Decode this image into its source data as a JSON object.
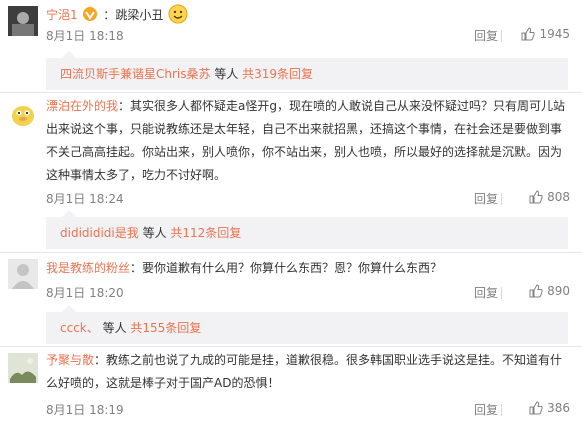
{
  "comments": [
    {
      "user": "宁浥1",
      "text_before": "：",
      "text": "跳梁小丑",
      "time": "8月1日 18:18",
      "reply": "回复",
      "likes": "1945",
      "sub": {
        "users": "四流贝斯手兼谐星Chris桑苏",
        "middle": " 等人 ",
        "count": "共319条回复"
      }
    },
    {
      "user": "漂泊在外的我",
      "text": "：其实很多人都怀疑走a怪开g，现在喷的人敢说自己从来没怀疑过吗？只有周可儿站出来说这个事，只能说教练还是太年轻，自己不出来就招黑，还搞这个事情，在社会还是要做到事不关己高高挂起。你站出来，别人喷你，你不站出来，别人也喷，所以最好的选择就是沉默。因为这种事情太多了，吃力不讨好啊。",
      "time": "8月1日 18:24",
      "reply": "回复",
      "likes": "808",
      "sub": {
        "users": "dididididi是我",
        "middle": " 等人 ",
        "count": "共112条回复"
      }
    },
    {
      "user": "我是教练的粉丝",
      "text": "：要你道歉有什么用？你算什么东西？恩？你算什么东西？",
      "time": "8月1日 18:20",
      "reply": "回复",
      "likes": "890",
      "sub": {
        "users": "ccck、",
        "middle": " 等人 ",
        "count": "共155条回复"
      }
    },
    {
      "user": "予聚与散",
      "text": "：教练之前也说了九成的可能是挂，道歉很稳。很多韩国职业选手说这是挂。不知道有什么好喷的，这就是棒子对于国产AD的恐惧！",
      "time": "8月1日 18:19",
      "reply": "回复",
      "likes": "386"
    }
  ],
  "colors": {
    "accent": "#eb7350",
    "meta": "#808080",
    "sub_bg": "#f2f2f5"
  }
}
